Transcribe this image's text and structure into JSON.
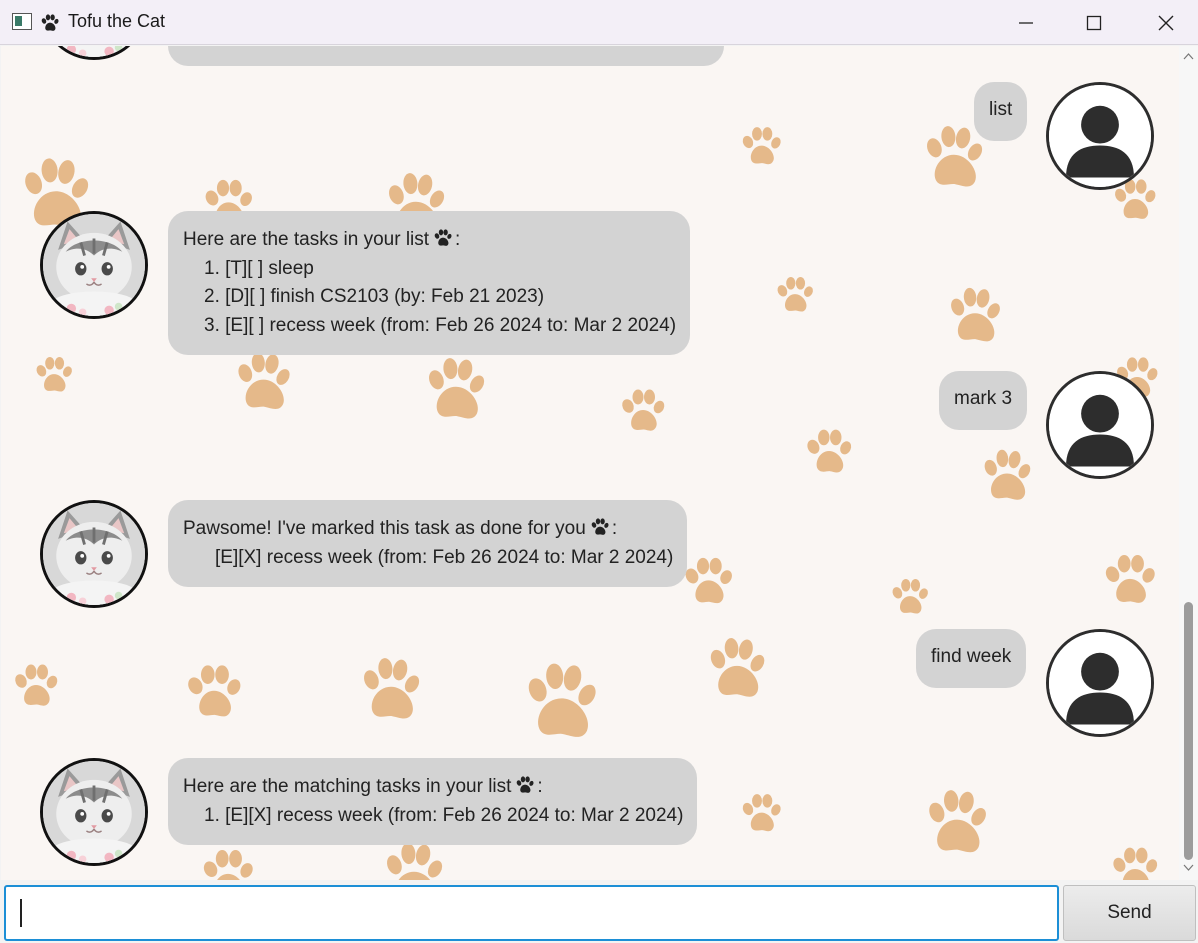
{
  "window": {
    "title": "Tofu the Cat",
    "icons": [
      "app-icon",
      "paw-icon",
      "minimize-icon",
      "maximize-icon",
      "close-icon"
    ]
  },
  "colors": {
    "chat_background": "#faf6f3",
    "paw_print": "#e5b98a",
    "bubble": "#d3d3d3",
    "input_focus_border": "#1c8fd6"
  },
  "messages": [
    {
      "sender": "user",
      "lines": [
        "list"
      ]
    },
    {
      "sender": "bot",
      "lines": [
        "Here are the tasks in your list",
        ":",
        "1. [T][ ] sleep",
        "2. [D][ ] finish CS2103 (by: Feb 21 2023)",
        "3. [E][ ] recess week (from: Feb 26 2024 to: Mar 2 2024)"
      ]
    },
    {
      "sender": "user",
      "lines": [
        "mark 3"
      ]
    },
    {
      "sender": "bot",
      "lines": [
        "Pawsome! I've marked this task as done for you",
        ":",
        "[E][X] recess week (from: Feb 26 2024 to: Mar 2 2024)"
      ]
    },
    {
      "sender": "user",
      "lines": [
        "find week"
      ]
    },
    {
      "sender": "bot",
      "lines": [
        "Here are the matching tasks in your list",
        ":",
        "1. [E][X] recess week (from: Feb 26 2024 to: Mar 2 2024)"
      ]
    }
  ],
  "input": {
    "value": "",
    "placeholder": ""
  },
  "send_button": {
    "label": "Send"
  }
}
